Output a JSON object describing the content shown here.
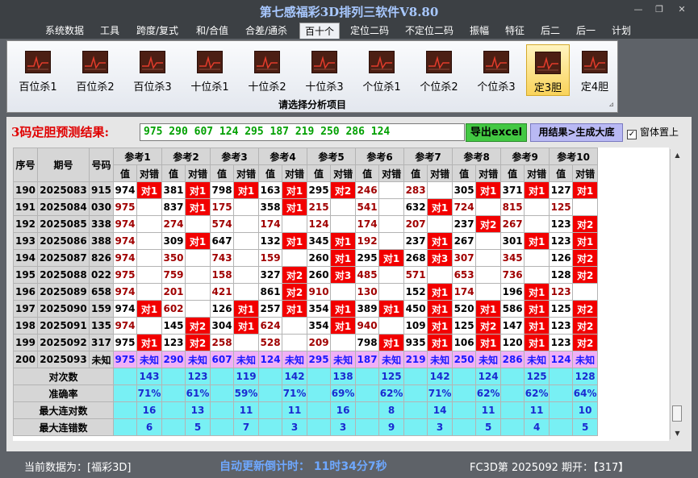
{
  "window": {
    "title": "第七感福彩3D排列三软件V8.80",
    "minimize_icon": "minimize-icon",
    "restore_icon": "restore-icon",
    "close_icon": "close-icon",
    "minimize_glyph": "—",
    "restore_glyph": "❐",
    "close_glyph": "✕"
  },
  "menu": {
    "items": [
      {
        "label": "系统数据"
      },
      {
        "label": "工具"
      },
      {
        "label": "跨度/复式"
      },
      {
        "label": "和/合值"
      },
      {
        "label": "合差/通杀"
      },
      {
        "label": "百十个"
      },
      {
        "label": "定位二码"
      },
      {
        "label": "不定位二码"
      },
      {
        "label": "振幅"
      },
      {
        "label": "特征"
      },
      {
        "label": "后二"
      },
      {
        "label": "后一"
      },
      {
        "label": "计划"
      }
    ],
    "active": "百十个"
  },
  "ribbon": {
    "buttons": [
      {
        "label": "百位杀1",
        "icon": "chart-icon"
      },
      {
        "label": "百位杀2",
        "icon": "chart-icon"
      },
      {
        "label": "百位杀3",
        "icon": "chart-icon"
      },
      {
        "label": "十位杀1",
        "icon": "chart-icon"
      },
      {
        "label": "十位杀2",
        "icon": "chart-icon"
      },
      {
        "label": "十位杀3",
        "icon": "chart-icon"
      },
      {
        "label": "个位杀1",
        "icon": "chart-icon"
      },
      {
        "label": "个位杀2",
        "icon": "chart-icon"
      },
      {
        "label": "个位杀3",
        "icon": "chart-icon"
      },
      {
        "label": "定3胆",
        "icon": "chart-icon"
      },
      {
        "label": "定4胆",
        "icon": "chart-icon"
      }
    ],
    "active": "定3胆",
    "caption": "请选择分析项目",
    "corner_icon": "dialog-launcher-icon",
    "corner_glyph": "⊿"
  },
  "prediction": {
    "label": "3码定胆预测结果:",
    "result": "975 290 607 124 295 187 219 250 286 124",
    "export_label": "导出excel",
    "generate_label": "用结果>生成大底",
    "on_top_label": "窗体置上",
    "on_top_checked": true,
    "check_glyph": "✓"
  },
  "table": {
    "headers": {
      "seq": "序号",
      "issue": "期号",
      "number": "号码",
      "refs": [
        "参考1",
        "参考2",
        "参考3",
        "参考4",
        "参考5",
        "参考6",
        "参考7",
        "参考8",
        "参考9",
        "参考10"
      ],
      "value": "值",
      "result": "对错"
    },
    "rows": [
      {
        "seq": "190",
        "issue": "2025083",
        "number": "915",
        "cells": [
          [
            "974",
            "对1"
          ],
          [
            "381",
            "对1"
          ],
          [
            "798",
            "对1"
          ],
          [
            "163",
            "对1"
          ],
          [
            "295",
            "对2"
          ],
          [
            "246",
            ""
          ],
          [
            "283",
            ""
          ],
          [
            "305",
            "对1"
          ],
          [
            "371",
            "对1"
          ],
          [
            "127",
            "对1"
          ]
        ]
      },
      {
        "seq": "191",
        "issue": "2025084",
        "number": "030",
        "cells": [
          [
            "975",
            ""
          ],
          [
            "837",
            "对1"
          ],
          [
            "175",
            ""
          ],
          [
            "358",
            "对1"
          ],
          [
            "215",
            ""
          ],
          [
            "541",
            ""
          ],
          [
            "632",
            "对1"
          ],
          [
            "724",
            ""
          ],
          [
            "815",
            ""
          ],
          [
            "125",
            ""
          ]
        ]
      },
      {
        "seq": "192",
        "issue": "2025085",
        "number": "338",
        "cells": [
          [
            "974",
            ""
          ],
          [
            "274",
            ""
          ],
          [
            "574",
            ""
          ],
          [
            "174",
            ""
          ],
          [
            "124",
            ""
          ],
          [
            "174",
            ""
          ],
          [
            "207",
            ""
          ],
          [
            "237",
            "对2"
          ],
          [
            "267",
            ""
          ],
          [
            "123",
            "对2"
          ]
        ]
      },
      {
        "seq": "193",
        "issue": "2025086",
        "number": "388",
        "cells": [
          [
            "974",
            ""
          ],
          [
            "309",
            "对1"
          ],
          [
            "647",
            ""
          ],
          [
            "132",
            "对1"
          ],
          [
            "345",
            "对1"
          ],
          [
            "192",
            ""
          ],
          [
            "237",
            "对1"
          ],
          [
            "267",
            ""
          ],
          [
            "301",
            "对1"
          ],
          [
            "123",
            "对1"
          ]
        ]
      },
      {
        "seq": "194",
        "issue": "2025087",
        "number": "826",
        "cells": [
          [
            "974",
            ""
          ],
          [
            "350",
            ""
          ],
          [
            "743",
            ""
          ],
          [
            "159",
            ""
          ],
          [
            "260",
            "对1"
          ],
          [
            "295",
            "对1"
          ],
          [
            "268",
            "对3"
          ],
          [
            "307",
            ""
          ],
          [
            "345",
            ""
          ],
          [
            "126",
            "对2"
          ]
        ]
      },
      {
        "seq": "195",
        "issue": "2025088",
        "number": "022",
        "cells": [
          [
            "975",
            ""
          ],
          [
            "759",
            ""
          ],
          [
            "158",
            ""
          ],
          [
            "327",
            "对2"
          ],
          [
            "260",
            "对3"
          ],
          [
            "485",
            ""
          ],
          [
            "571",
            ""
          ],
          [
            "653",
            ""
          ],
          [
            "736",
            ""
          ],
          [
            "128",
            "对2"
          ]
        ]
      },
      {
        "seq": "196",
        "issue": "2025089",
        "number": "658",
        "cells": [
          [
            "974",
            ""
          ],
          [
            "201",
            ""
          ],
          [
            "421",
            ""
          ],
          [
            "861",
            "对2"
          ],
          [
            "910",
            ""
          ],
          [
            "130",
            ""
          ],
          [
            "152",
            "对1"
          ],
          [
            "174",
            ""
          ],
          [
            "196",
            "对1"
          ],
          [
            "123",
            ""
          ]
        ]
      },
      {
        "seq": "197",
        "issue": "2025090",
        "number": "159",
        "cells": [
          [
            "974",
            "对1"
          ],
          [
            "602",
            ""
          ],
          [
            "126",
            "对1"
          ],
          [
            "257",
            "对1"
          ],
          [
            "354",
            "对1"
          ],
          [
            "389",
            "对1"
          ],
          [
            "450",
            "对1"
          ],
          [
            "520",
            "对1"
          ],
          [
            "586",
            "对1"
          ],
          [
            "125",
            "对2"
          ]
        ]
      },
      {
        "seq": "198",
        "issue": "2025091",
        "number": "135",
        "cells": [
          [
            "974",
            ""
          ],
          [
            "145",
            "对2"
          ],
          [
            "304",
            "对1"
          ],
          [
            "624",
            ""
          ],
          [
            "354",
            "对1"
          ],
          [
            "940",
            ""
          ],
          [
            "109",
            "对1"
          ],
          [
            "125",
            "对2"
          ],
          [
            "147",
            "对1"
          ],
          [
            "123",
            "对2"
          ]
        ]
      },
      {
        "seq": "199",
        "issue": "2025092",
        "number": "317",
        "cells": [
          [
            "975",
            "对1"
          ],
          [
            "123",
            "对2"
          ],
          [
            "258",
            ""
          ],
          [
            "528",
            ""
          ],
          [
            "209",
            ""
          ],
          [
            "798",
            "对1"
          ],
          [
            "935",
            "对1"
          ],
          [
            "106",
            "对1"
          ],
          [
            "120",
            "对1"
          ],
          [
            "123",
            "对2"
          ]
        ]
      },
      {
        "seq": "200",
        "issue": "2025093",
        "number": "未知",
        "cells": [
          [
            "975",
            "未知"
          ],
          [
            "290",
            "未知"
          ],
          [
            "607",
            "未知"
          ],
          [
            "124",
            "未知"
          ],
          [
            "295",
            "未知"
          ],
          [
            "187",
            "未知"
          ],
          [
            "219",
            "未知"
          ],
          [
            "250",
            "未知"
          ],
          [
            "286",
            "未知"
          ],
          [
            "124",
            "未知"
          ]
        ]
      }
    ],
    "value_colors": [
      [
        "#000000",
        "#000000",
        "#000000",
        "#000000",
        "#000000",
        "#a00000",
        "#a00000",
        "#000000",
        "#000000",
        "#000000"
      ],
      [
        "#a00000",
        "#000000",
        "#a00000",
        "#000000",
        "#a00000",
        "#a00000",
        "#000000",
        "#a00000",
        "#a00000",
        "#a00000"
      ],
      [
        "#a00000",
        "#a00000",
        "#a00000",
        "#a00000",
        "#a00000",
        "#a00000",
        "#a00000",
        "#000000",
        "#a00000",
        "#000000"
      ],
      [
        "#a00000",
        "#000000",
        "#000000",
        "#000000",
        "#000000",
        "#a00000",
        "#000000",
        "#000000",
        "#000000",
        "#000000"
      ],
      [
        "#a00000",
        "#a00000",
        "#a00000",
        "#a00000",
        "#000000",
        "#000000",
        "#000000",
        "#a00000",
        "#a00000",
        "#000000"
      ],
      [
        "#a00000",
        "#a00000",
        "#a00000",
        "#000000",
        "#000000",
        "#a00000",
        "#a00000",
        "#a00000",
        "#a00000",
        "#000000"
      ],
      [
        "#a00000",
        "#a00000",
        "#a00000",
        "#000000",
        "#a00000",
        "#a00000",
        "#000000",
        "#a00000",
        "#000000",
        "#a00000"
      ],
      [
        "#000000",
        "#a00000",
        "#000000",
        "#000000",
        "#000000",
        "#000000",
        "#000000",
        "#000000",
        "#000000",
        "#000000"
      ],
      [
        "#a00000",
        "#000000",
        "#000000",
        "#a00000",
        "#000000",
        "#a00000",
        "#000000",
        "#000000",
        "#000000",
        "#000000"
      ],
      [
        "#000000",
        "#000000",
        "#a00000",
        "#a00000",
        "#a00000",
        "#000000",
        "#000000",
        "#000000",
        "#000000",
        "#000000"
      ]
    ],
    "stats": [
      {
        "label": "对次数",
        "values": [
          "143",
          "123",
          "119",
          "142",
          "138",
          "125",
          "142",
          "124",
          "125",
          "128"
        ]
      },
      {
        "label": "准确率",
        "values": [
          "71%",
          "61%",
          "59%",
          "71%",
          "69%",
          "62%",
          "71%",
          "62%",
          "62%",
          "64%"
        ]
      },
      {
        "label": "最大连对数",
        "values": [
          "16",
          "13",
          "11",
          "11",
          "16",
          "8",
          "14",
          "11",
          "11",
          "10"
        ]
      },
      {
        "label": "最大连错数",
        "values": [
          "6",
          "5",
          "7",
          "3",
          "3",
          "9",
          "3",
          "5",
          "4",
          "5"
        ]
      }
    ]
  },
  "scrollbar": {
    "up_glyph": "▲",
    "down_glyph": "▼"
  },
  "status": {
    "current": "当前数据为：[福彩3D]",
    "countdown": "自动更新倒计时：  11时34分7秒",
    "issue": "FC3D第 2025092 期开：【317】"
  }
}
